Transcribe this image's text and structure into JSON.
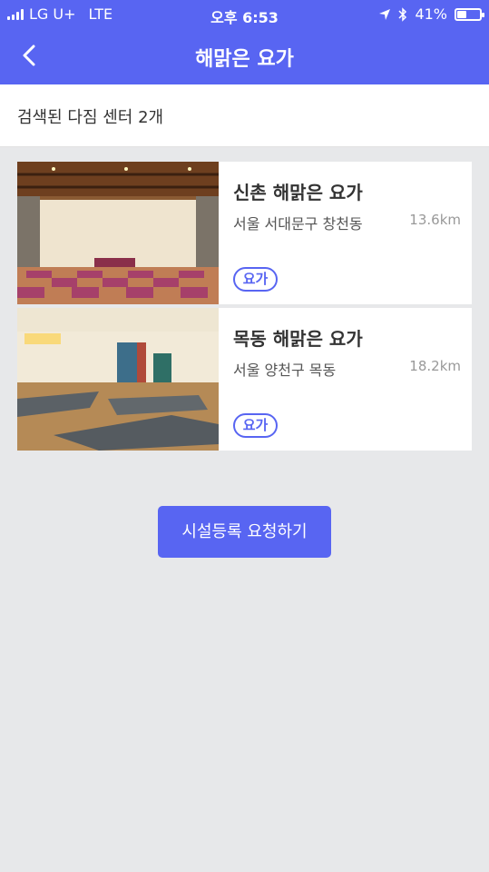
{
  "status_bar": {
    "carrier": "LG U+",
    "network": "LTE",
    "time": "오후 6:53",
    "battery_text": "41%",
    "battery_level": 0.41,
    "icons": [
      "signal-icon",
      "location-arrow-icon",
      "bluetooth-icon",
      "battery-icon"
    ]
  },
  "header": {
    "title": "해맑은 요가",
    "back_icon": "chevron-left-icon",
    "color": "#5865f2"
  },
  "result_summary": "검색된 다짐 센터 2개",
  "centers": [
    {
      "name": "신촌 해맑은 요가",
      "address": "서울 서대문구 창천동",
      "distance": "13.6km",
      "tag": "요가"
    },
    {
      "name": "목동 해맑은 요가",
      "address": "서울 양천구 목동",
      "distance": "18.2km",
      "tag": "요가"
    }
  ],
  "request_button": "시설등록 요청하기"
}
